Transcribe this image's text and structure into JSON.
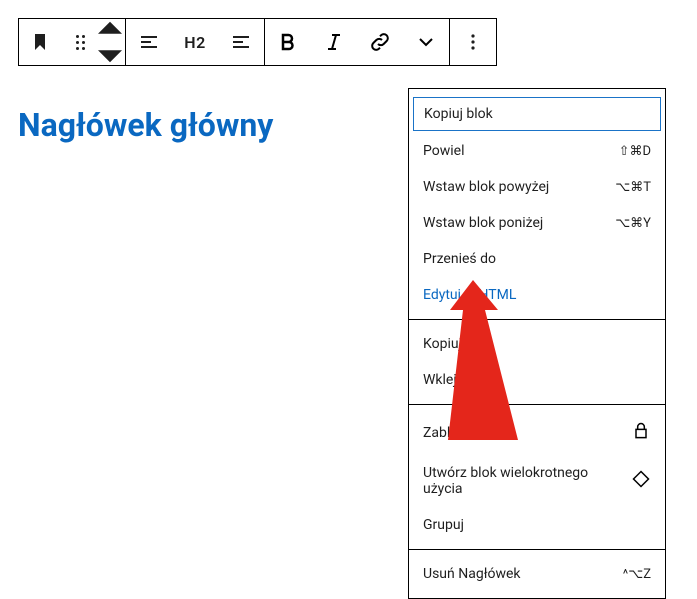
{
  "toolbar": {
    "heading_level": "H2"
  },
  "content": {
    "heading": "Nagłówek główny"
  },
  "menu": {
    "section1": [
      {
        "label": "Kopiuj blok",
        "shortcut": "",
        "highlighted": true
      },
      {
        "label": "Powiel",
        "shortcut": "⇧⌘D"
      },
      {
        "label": "Wstaw blok powyżej",
        "shortcut": "⌥⌘T"
      },
      {
        "label": "Wstaw blok poniżej",
        "shortcut": "⌥⌘Y"
      },
      {
        "label": "Przenieś do",
        "shortcut": ""
      },
      {
        "label": "Edytuj w HTML",
        "shortcut": "",
        "link": true
      }
    ],
    "section2": [
      {
        "label": "Kopiuj st"
      },
      {
        "label": "Wklej style"
      }
    ],
    "section3": [
      {
        "label": "Zablokuj",
        "icon": "lock"
      },
      {
        "label": "Utwórz blok wielokrotnego użycia",
        "icon": "reusable"
      },
      {
        "label": "Grupuj"
      }
    ],
    "section4": [
      {
        "label": "Usuń Nagłówek",
        "shortcut": "^⌥Z"
      }
    ]
  }
}
